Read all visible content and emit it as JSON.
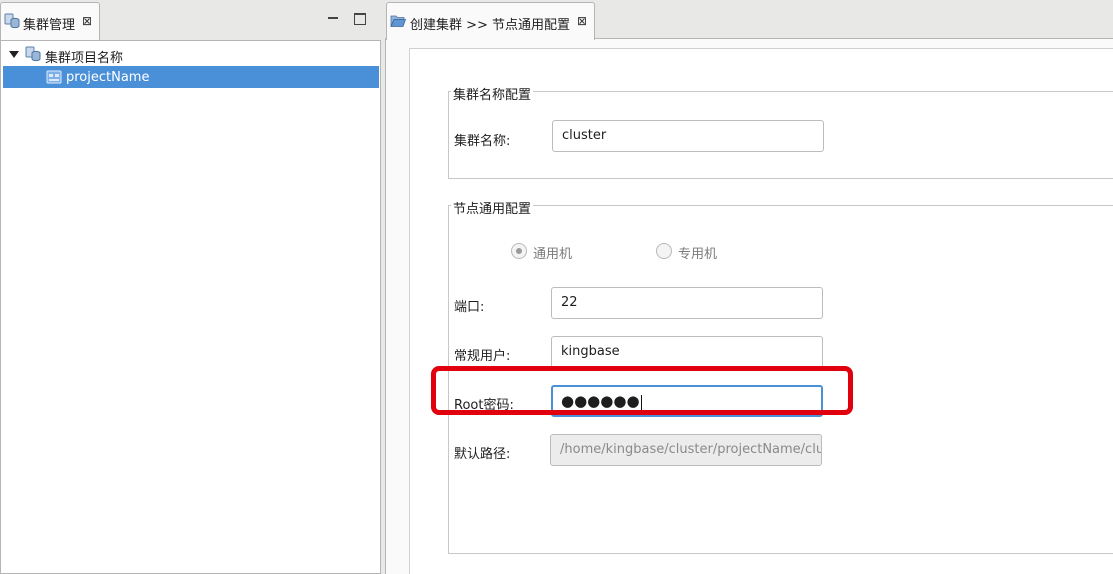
{
  "left_view": {
    "tab_title": "集群管理",
    "tree": {
      "root_label": "集群项目名称",
      "child_label": "projectName"
    }
  },
  "editor": {
    "tab_title": "创建集群 >> 节点通用配置",
    "cluster_group": {
      "title": "集群名称配置",
      "name_label": "集群名称:",
      "name_value": "cluster"
    },
    "node_group": {
      "title": "节点通用配置",
      "radio_general": "通用机",
      "radio_dedicated": "专用机",
      "selected_machine": "通用机",
      "port_label": "端口:",
      "port_value": "22",
      "user_label": "常规用户:",
      "user_value": "kingbase",
      "root_password_label": "Root密码:",
      "root_password_value": "●●●●●●",
      "path_label": "默认路径:",
      "path_value": "/home/kingbase/cluster/projectName/clu"
    }
  },
  "colors": {
    "selection": "#4a90d9",
    "highlight": "#e0000e",
    "focus_border": "#4a90d9"
  }
}
